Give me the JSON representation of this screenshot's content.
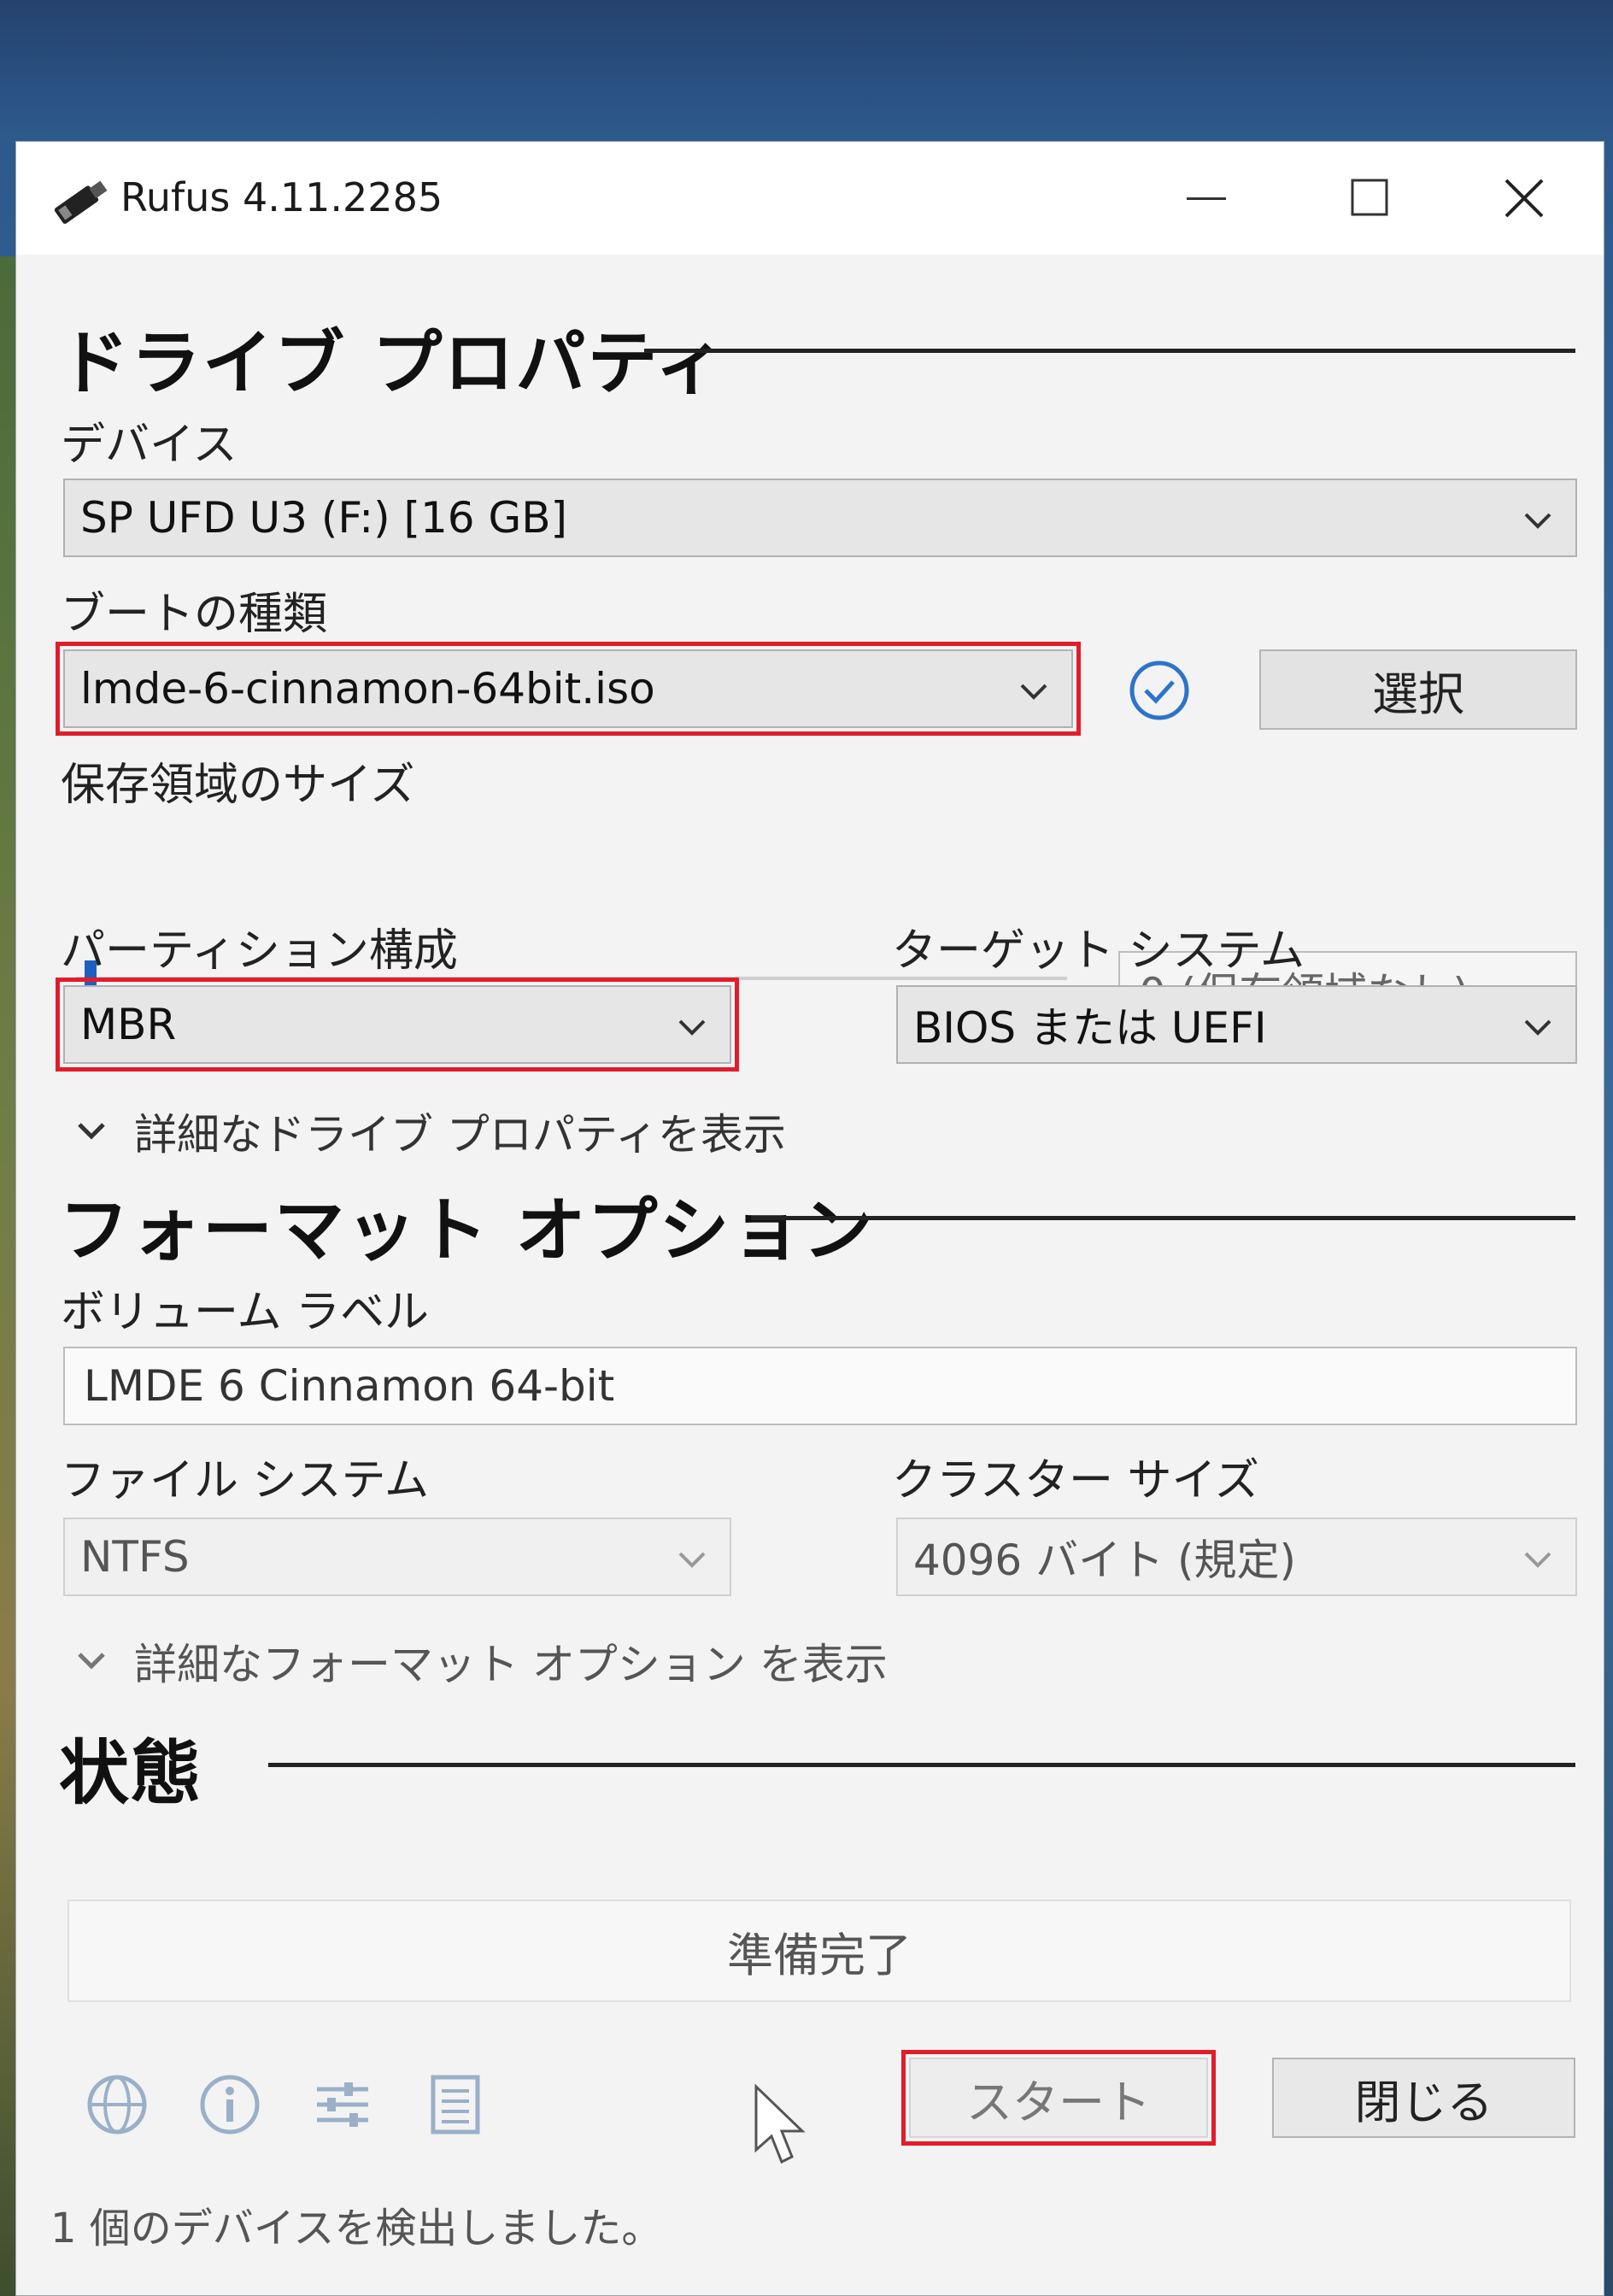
{
  "window": {
    "title": "Rufus 4.11.2285"
  },
  "drive_properties": {
    "heading": "ドライブ プロパティ",
    "device_label": "デバイス",
    "device_value": "SP UFD U3 (F:) [16 GB]",
    "boot_type_label": "ブートの種類",
    "boot_type_value": "lmde-6-cinnamon-64bit.iso",
    "select_button": "選択",
    "persistent_label": "保存領域のサイズ",
    "persistent_value": "0 (保存領域なし)",
    "partition_label": "パーティション構成",
    "partition_value": "MBR",
    "target_label": "ターゲット システム",
    "target_value": "BIOS または UEFI",
    "advanced_toggle": "詳細なドライブ プロパティを表示"
  },
  "format_options": {
    "heading": "フォーマット オプション",
    "volume_label_label": "ボリューム ラベル",
    "volume_label_value": "LMDE 6 Cinnamon 64-bit",
    "filesystem_label": "ファイル システム",
    "filesystem_value": "NTFS",
    "cluster_label": "クラスター サイズ",
    "cluster_value": "4096 バイト (規定)",
    "advanced_toggle": "詳細なフォーマット オプション を表示"
  },
  "status": {
    "heading": "状態",
    "progress_text": "準備完了",
    "start_button": "スタート",
    "close_button": "閉じる",
    "footer_text": "1 個のデバイスを検出しました。"
  },
  "colors": {
    "highlight": "#e21c2b",
    "check": "#2c74c9",
    "slider_thumb": "#1f5fbf"
  },
  "icons": {
    "app": "usb-stick-icon",
    "check": "check-circle-icon",
    "toolbar": [
      "globe-icon",
      "info-icon",
      "settings-sliders-icon",
      "log-icon"
    ]
  }
}
